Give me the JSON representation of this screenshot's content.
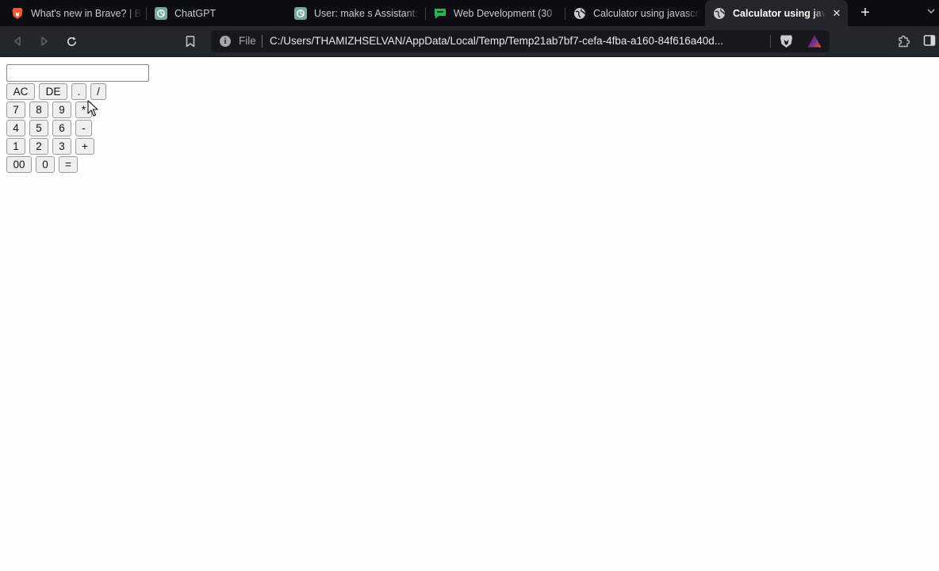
{
  "browser": {
    "tabs": [
      {
        "title": "What's new in Brave? | Br",
        "icon": "brave-lion-icon",
        "active": false
      },
      {
        "title": "ChatGPT",
        "icon": "chatgpt-icon",
        "active": false
      },
      {
        "title": "User: make s Assistant: C",
        "icon": "chatgpt-icon",
        "active": false
      },
      {
        "title": "Web Development (30",
        "icon": "chat-bubble-icon",
        "active": false
      },
      {
        "title": "Calculator using javascrip",
        "icon": "globe-icon",
        "active": false
      },
      {
        "title": "Calculator using java",
        "icon": "globe-icon",
        "active": true
      }
    ],
    "new_tab_label": "+",
    "address_bar": {
      "scheme_label": "File",
      "url": "C:/Users/THAMIZHSELVAN/AppData/Local/Temp/Temp21ab7bf7-cefa-4fba-a160-84f616a40d..."
    },
    "colors": {
      "tabstrip": "#0c0d10",
      "toolbar": "#23262b",
      "brave_orange": "#fb542b"
    }
  },
  "calculator": {
    "display_value": "",
    "rows": [
      [
        "AC",
        "DE",
        ".",
        "/"
      ],
      [
        "7",
        "8",
        "9",
        "*"
      ],
      [
        "4",
        "5",
        "6",
        "-"
      ],
      [
        "1",
        "2",
        "3",
        "+"
      ],
      [
        "00",
        "0",
        "="
      ]
    ]
  }
}
